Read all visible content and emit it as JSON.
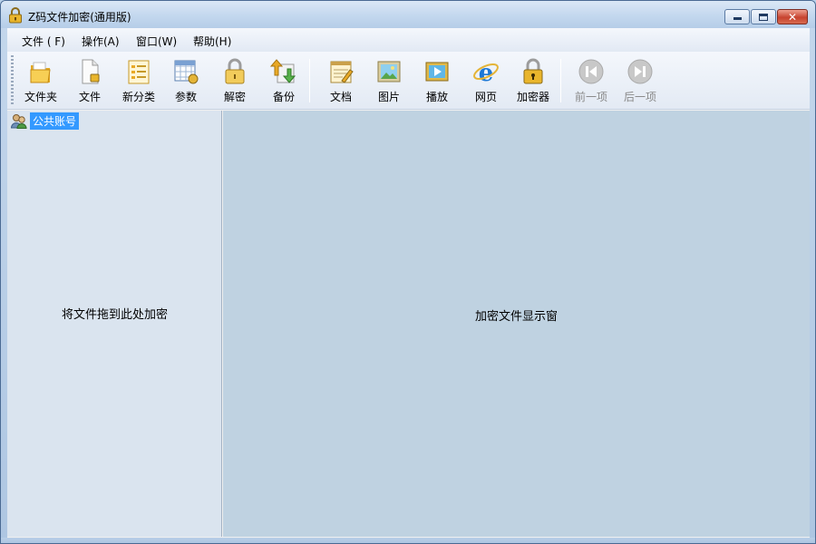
{
  "window": {
    "title": "Z码文件加密(通用版)"
  },
  "menu": [
    {
      "label": "文件 ( F)"
    },
    {
      "label": "操作(A)"
    },
    {
      "label": "窗口(W)"
    },
    {
      "label": "帮助(H)"
    }
  ],
  "toolbar": {
    "folder": "文件夹",
    "file": "文件",
    "new_category": "新分类",
    "params": "参数",
    "decrypt": "解密",
    "backup": "备份",
    "document": "文档",
    "picture": "图片",
    "play": "播放",
    "webpage": "网页",
    "encryptor": "加密器",
    "prev": "前一项",
    "next": "后一项"
  },
  "tree": {
    "root_label": "公共账号"
  },
  "left_pane": {
    "hint": "将文件拖到此处加密"
  },
  "right_pane": {
    "hint": "加密文件显示窗"
  },
  "colors": {
    "selection": "#3399ff",
    "left_bg": "#dae4ef",
    "right_bg": "#bfd2e1"
  }
}
